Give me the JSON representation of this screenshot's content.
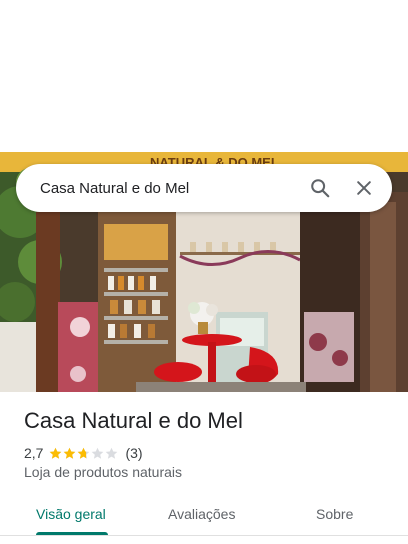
{
  "search": {
    "query": "Casa Natural e do Mel",
    "search_icon": "search-icon",
    "close_icon": "close-icon"
  },
  "photo": {
    "banner_text": "NATURAL & DO MEL"
  },
  "place": {
    "title": "Casa Natural e do Mel",
    "rating": "2,7",
    "rating_value": 2.7,
    "rating_max": 5,
    "review_count": "(3)",
    "category": "Loja de produtos naturais"
  },
  "tabs": [
    {
      "label": "Visão geral",
      "active": true
    },
    {
      "label": "Avaliações",
      "active": false
    },
    {
      "label": "Sobre",
      "active": false
    }
  ],
  "colors": {
    "accent": "#00796b",
    "star": "#fbbc04",
    "star_empty": "#dadce0"
  }
}
